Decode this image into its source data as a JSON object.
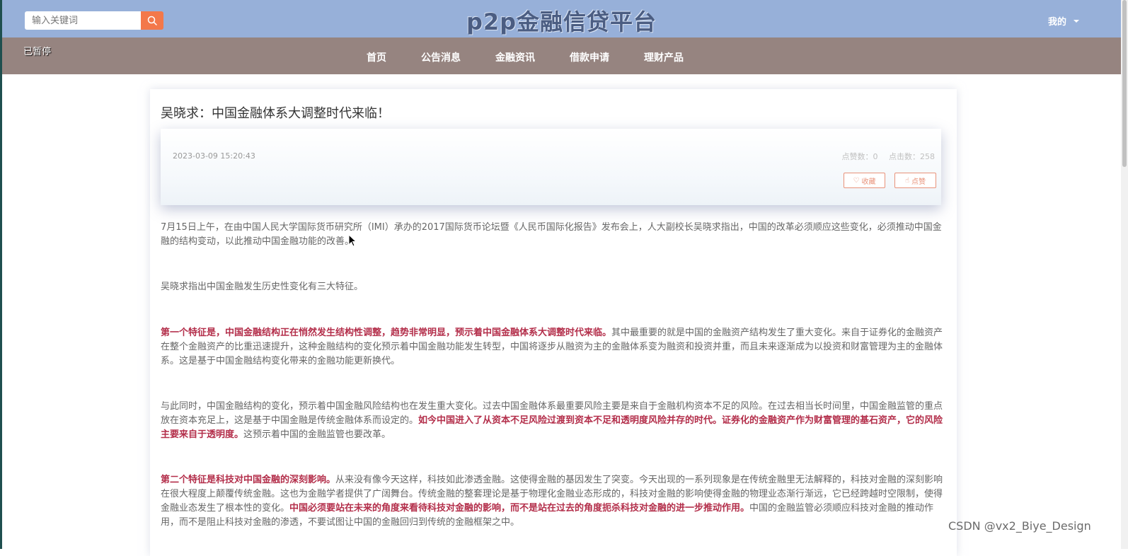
{
  "header": {
    "search_placeholder": "输入关键词",
    "site_title": "p2p金融信贷平台",
    "user_menu": "我的"
  },
  "status_overlay": "已暂停",
  "nav": {
    "items": [
      "首页",
      "公告消息",
      "金融资讯",
      "借款申请",
      "理财产品"
    ]
  },
  "article": {
    "title": "吴晓求：中国金融体系大调整时代来临！",
    "date": "2023-03-09 15:20:43",
    "likes_label": "点赞数：0",
    "clicks_label": "点击数：258",
    "collect_button": "收藏",
    "like_button": "点赞",
    "paragraphs": [
      {
        "normal_a": "7月15日上午，在由中国人民大学国际货币研究所（IMI）承办的2017国际货币论坛暨《人民币国际化报告》发布会上，人大副校长吴晓求指出，中国的改革必须顺应这些变化，必须推动中国金融的结构变动，以此推动中国金融功能的改善。"
      },
      {
        "normal_a": "吴晓求指出中国金融发生历史性变化有三大特征。"
      },
      {
        "bold_a": "第一个特征是，中国金融结构正在悄然发生结构性调整，趋势非常明显，预示着中国金融体系大调整时代来临。",
        "normal_a": "其中最重要的就是中国的金融资产结构发生了重大变化。来自于证券化的金融资产在整个金融资产的比重迅速提升，这种金融结构的变化预示着中国金融功能发生转型，中国将逐步从融资为主的金融体系变为融资和投资并重，而且未来逐渐成为以投资和财富管理为主的金融体系。这是基于中国金融结构变化带来的金融功能更新换代。"
      },
      {
        "normal_a": "与此同时，中国金融结构的变化，预示着中国金融风险结构也在发生重大变化。过去中国金融体系最重要风险主要是来自于金融机构资本不足的风险。在过去相当长时间里，中国金融监管的重点放在资本充足上，这是基于中国金融是传统金融体系而设定的。",
        "bold_a": "如今中国进入了从资本不足风险过渡到资本不足和透明度风险并存的时代。证券化的金融资产作为财富管理的基石资产，它的风险主要来自于透明度。",
        "normal_b": "这预示着中国的金融监管也要改革。"
      },
      {
        "bold_a": "第二个特征是科技对中国金融的深刻影响。",
        "normal_a": "从来没有像今天这样，科技如此渗透金融。这使得金融的基因发生了突变。今天出现的一系列现象是在传统金融里无法解释的，科技对金融的深刻影响在很大程度上颠覆传统金融。这也为金融学者提供了广阔舞台。传统金融的整套理论是基于物理化金融业态形成的，科技对金融的影响使得金融的物理业态渐行渐远，它已经跨越时空限制，使得金融业态发生了根本性的变化。",
        "bold_b": "中国必须要站在未来的角度来看待科技对金融的影响，而不是站在过去的角度扼杀科技对金融的进一步推动作用。",
        "normal_b": "中国的金融监管必须顺应科技对金融的推动作用，而不是阻止科技对金融的渗透，不要试图让中国的金融回归到传统的金融框架之中。"
      }
    ]
  },
  "watermark": "CSDN @vx2_Biye_Design",
  "colors": {
    "topbar": "#97b0d9",
    "navbar": "#968480",
    "search_button": "#f3784a",
    "highlight_text": "#b32e4a",
    "button_border": "#e8927a"
  }
}
